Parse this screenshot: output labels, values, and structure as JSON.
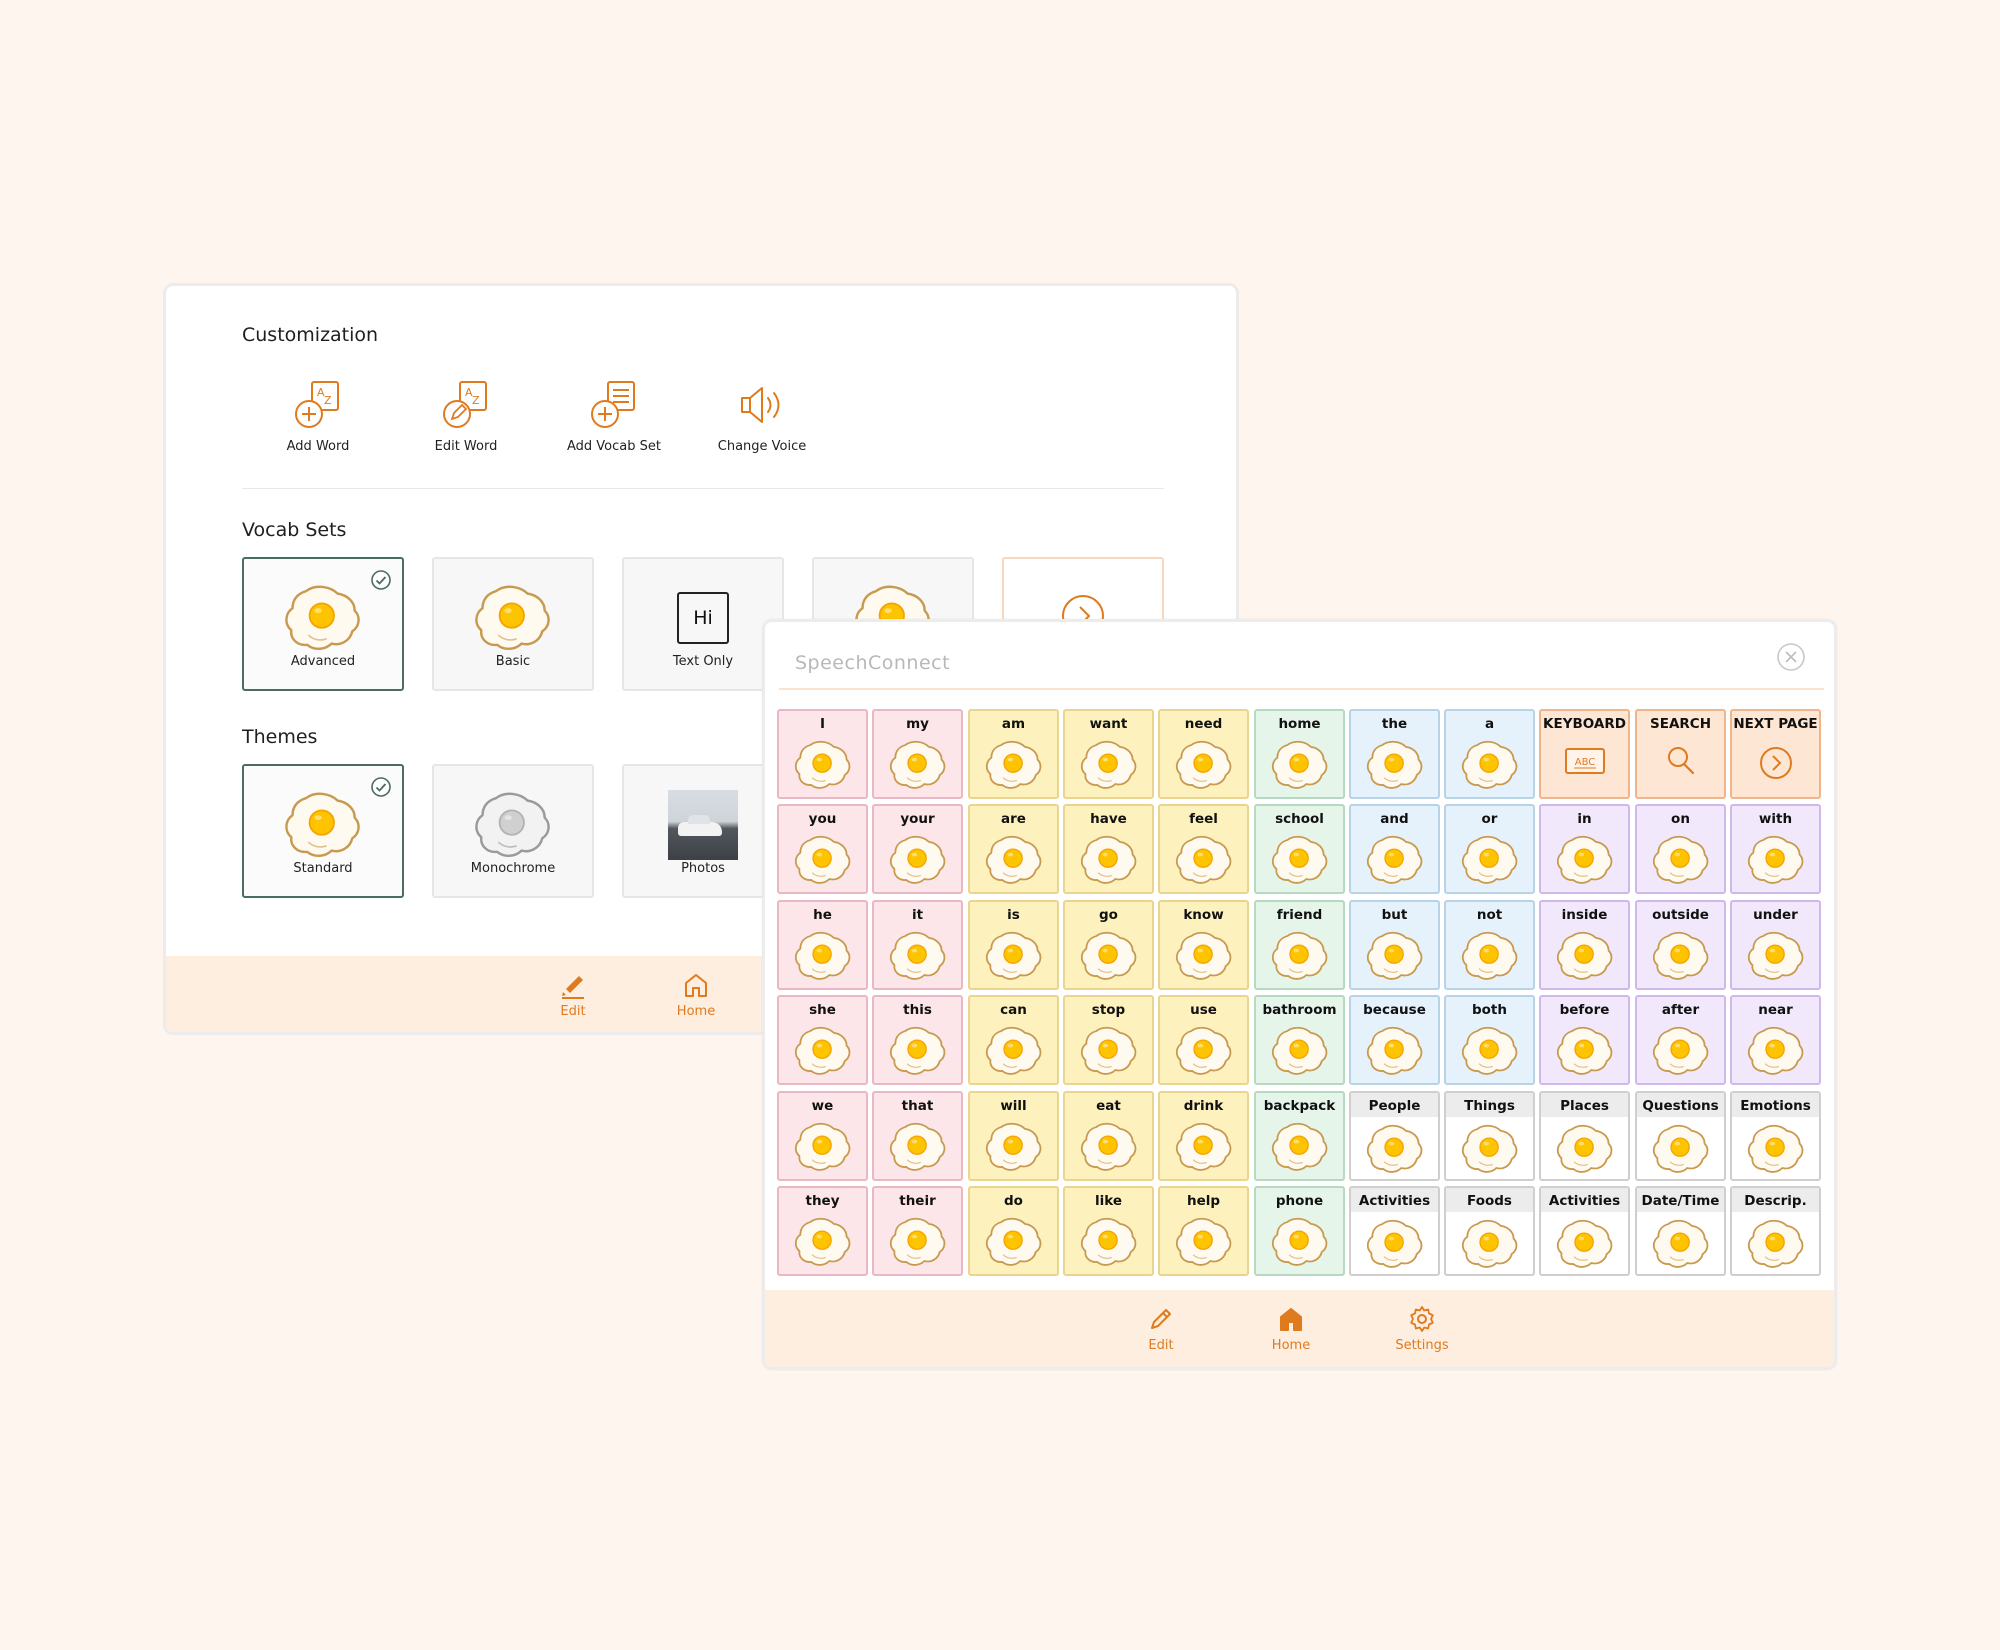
{
  "settings": {
    "customization_title": "Customization",
    "tools": [
      {
        "label": "Add Word",
        "icon": "add-word-icon"
      },
      {
        "label": "Edit Word",
        "icon": "edit-word-icon"
      },
      {
        "label": "Add Vocab Set",
        "icon": "add-vocab-set-icon"
      },
      {
        "label": "Change Voice",
        "icon": "speaker-icon"
      }
    ],
    "vocab_sets_title": "Vocab Sets",
    "vocab_sets": [
      {
        "label": "Advanced",
        "selected": true,
        "art": "fried-egg"
      },
      {
        "label": "Basic",
        "selected": false,
        "art": "fried-egg"
      },
      {
        "label": "Text Only",
        "selected": false,
        "art": "text",
        "text": "Hi"
      },
      {
        "label": "",
        "selected": false,
        "art": "fried-egg"
      }
    ],
    "themes_title": "Themes",
    "themes": [
      {
        "label": "Standard",
        "selected": true,
        "art": "fried-egg"
      },
      {
        "label": "Monochrome",
        "selected": false,
        "art": "fried-egg-gray"
      },
      {
        "label": "Photos",
        "selected": false,
        "art": "photo"
      }
    ],
    "footer": [
      {
        "label": "Edit",
        "icon": "pencil-icon"
      },
      {
        "label": "Home",
        "icon": "home-icon"
      }
    ]
  },
  "board": {
    "app_title": "SpeechConnect",
    "rows": [
      [
        [
          "I",
          "pink"
        ],
        [
          "my",
          "pink"
        ],
        [
          "am",
          "yellow"
        ],
        [
          "want",
          "yellow"
        ],
        [
          "need",
          "yellow"
        ],
        [
          "home",
          "green"
        ],
        [
          "the",
          "blue"
        ],
        [
          "a",
          "blue"
        ],
        [
          "KEYBOARD",
          "orange",
          "keyboard"
        ],
        [
          "SEARCH",
          "orange",
          "search"
        ],
        [
          "NEXT PAGE",
          "orange",
          "next"
        ]
      ],
      [
        [
          "you",
          "pink"
        ],
        [
          "your",
          "pink"
        ],
        [
          "are",
          "yellow"
        ],
        [
          "have",
          "yellow"
        ],
        [
          "feel",
          "yellow"
        ],
        [
          "school",
          "green"
        ],
        [
          "and",
          "blue"
        ],
        [
          "or",
          "blue"
        ],
        [
          "in",
          "purple"
        ],
        [
          "on",
          "purple"
        ],
        [
          "with",
          "purple"
        ]
      ],
      [
        [
          "he",
          "pink"
        ],
        [
          "it",
          "pink"
        ],
        [
          "is",
          "yellow"
        ],
        [
          "go",
          "yellow"
        ],
        [
          "know",
          "yellow"
        ],
        [
          "friend",
          "green"
        ],
        [
          "but",
          "blue"
        ],
        [
          "not",
          "blue"
        ],
        [
          "inside",
          "purple"
        ],
        [
          "outside",
          "purple"
        ],
        [
          "under",
          "purple"
        ]
      ],
      [
        [
          "she",
          "pink"
        ],
        [
          "this",
          "pink"
        ],
        [
          "can",
          "yellow"
        ],
        [
          "stop",
          "yellow"
        ],
        [
          "use",
          "yellow"
        ],
        [
          "bathroom",
          "green"
        ],
        [
          "because",
          "blue"
        ],
        [
          "both",
          "blue"
        ],
        [
          "before",
          "purple"
        ],
        [
          "after",
          "purple"
        ],
        [
          "near",
          "purple"
        ]
      ],
      [
        [
          "we",
          "pink"
        ],
        [
          "that",
          "pink"
        ],
        [
          "will",
          "yellow"
        ],
        [
          "eat",
          "yellow"
        ],
        [
          "drink",
          "yellow"
        ],
        [
          "backpack",
          "green"
        ],
        [
          "People",
          "white",
          "folder"
        ],
        [
          "Things",
          "white",
          "folder"
        ],
        [
          "Places",
          "white",
          "folder"
        ],
        [
          "Questions",
          "white",
          "folder"
        ],
        [
          "Emotions",
          "white",
          "folder"
        ]
      ],
      [
        [
          "they",
          "pink"
        ],
        [
          "their",
          "pink"
        ],
        [
          "do",
          "yellow"
        ],
        [
          "like",
          "yellow"
        ],
        [
          "help",
          "yellow"
        ],
        [
          "phone",
          "green"
        ],
        [
          "Activities",
          "white",
          "folder"
        ],
        [
          "Foods",
          "white",
          "folder"
        ],
        [
          "Activities",
          "white",
          "folder"
        ],
        [
          "Date/Time",
          "white",
          "folder"
        ],
        [
          "Descrip.",
          "white",
          "folder"
        ]
      ]
    ],
    "keyboard_text": "ABC",
    "footer": [
      {
        "label": "Edit",
        "icon": "pencil-icon"
      },
      {
        "label": "Home",
        "icon": "home-icon"
      },
      {
        "label": "Settings",
        "icon": "gear-icon"
      }
    ]
  },
  "colors": {
    "accent": "#e07a1f",
    "selected_border": "#4a6e5e"
  }
}
